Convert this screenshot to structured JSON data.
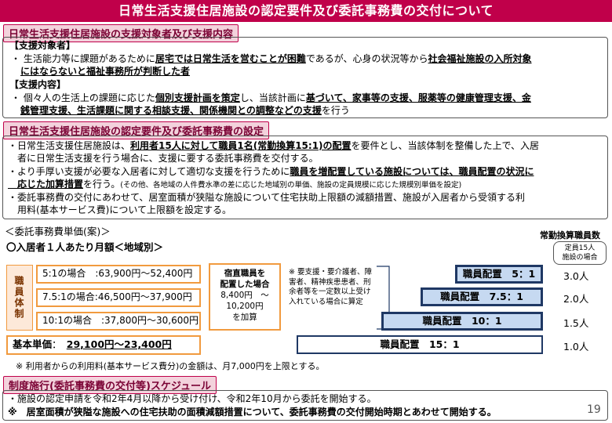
{
  "title": "日常生活支援住居施設の認定要件及び委託事務費の交付について",
  "page_number": "19",
  "section1": {
    "heading": "日常生活支援住居施設の支援対象者及び支援内容",
    "target_label": "【支援対象者】",
    "target_line1_a": "・ 生活能力等に課題があるために",
    "target_line1_u1": "居宅では日常生活を営むことが困難",
    "target_line1_b": "であるが、心身の状況等から",
    "target_line1_u2": "社会福祉施設の入所対象",
    "target_line2_u": "にはならないと福祉事務所が判断した者",
    "content_label": "【支援内容】",
    "content_line1_a": "・ 個々人の生活上の課題に応じた",
    "content_line1_u1": "個別支援計画を策定",
    "content_line1_b": "し、当該計画に",
    "content_line1_u2": "基づいて、家事等の支援、服薬等の健康管理支援、金",
    "content_line2_u": "銭管理支援、生活課題に関する相談支援、関係機関との調整などの支援",
    "content_line2_b": "を行う"
  },
  "section2": {
    "heading": "日常生活支援住居施設の認定要件及び委託事務費の設定",
    "p1_a": "・日常生活支援住居施設は、",
    "p1_u": "利用者15人に対して職員1名(常勤換算15:1)の配置",
    "p1_b": "を要件とし、当該体制を整備した上で、入居",
    "p1_c": "　者に日常生活支援を行う場合に、支援に要する委託事務費を交付する。",
    "p2_a": "・より手厚い支援が必要な入居者に対して適切な支援を行うために",
    "p2_u": "職員を増配置している施設については、職員配置の状況に",
    "p2_u2": "　応じた加算措置",
    "p2_b": "を行う。",
    "p2_small": "(その他、各地域の人件費水準の差に応じた地域別の単価、施設の定員規模に応じた規模別単価を設定)",
    "p3_a": "・委託事務費の交付にあわせて、居室面積が狭隘な施設について住宅扶助上限額の減額措置、施設が入居者から受領する利",
    "p3_b": "　用料(基本サービス費)について上限額を設定する。"
  },
  "unit_price": {
    "heading": "＜委託事務費単価(案)＞",
    "subheading": "〇入居者１人あたり月額＜地域別＞",
    "staff_label": "職員体制",
    "rows": [
      {
        "ratio": "5:1の場合",
        "price": "63,900円～52,400円"
      },
      {
        "ratio": "7.5:1の場合",
        "price": "46,500円～37,900円"
      },
      {
        "ratio": "10:1の場合",
        "price": "37,800円～30,600円"
      }
    ],
    "night_line1": "宿直職員を",
    "night_line2": "配置した場合",
    "night_line3": "8,400円　～",
    "night_line4": "10,200円",
    "night_line5": "を加算",
    "base_label": "基本単価",
    "base_price": "29,100円～23,400円",
    "note": "※ 利用者からの利用料(基本サービス費分)の金額は、月7,000円を上限とする。"
  },
  "staffing": {
    "header": "常勤換算職員数",
    "sub1": "定員15人",
    "sub2": "施設の場合",
    "memo": "※ 要支援・要介護者、障害者、精神疾患患者、刑余者等を一定数以上受け入れている場合に算定",
    "bars": [
      {
        "label": "職員配置　5：1",
        "count": "3.0人"
      },
      {
        "label": "職員配置　7.5：1",
        "count": "2.0人"
      },
      {
        "label": "職員配置　10：1",
        "count": "1.5人"
      },
      {
        "label": "職員配置　15：1",
        "count": "1.0人"
      }
    ]
  },
  "section3": {
    "heading": "制度施行(委託事務費の交付等)スケジュール",
    "line1": "・施設の認定申請を令和2年4月以降から受け付け、令和2年10月から委託を開始する。",
    "line2": "※　居室面積が狭隘な施設への住宅扶助の面積減額措置について、委託事務費の交付開始時期とあわせて開始する。"
  }
}
